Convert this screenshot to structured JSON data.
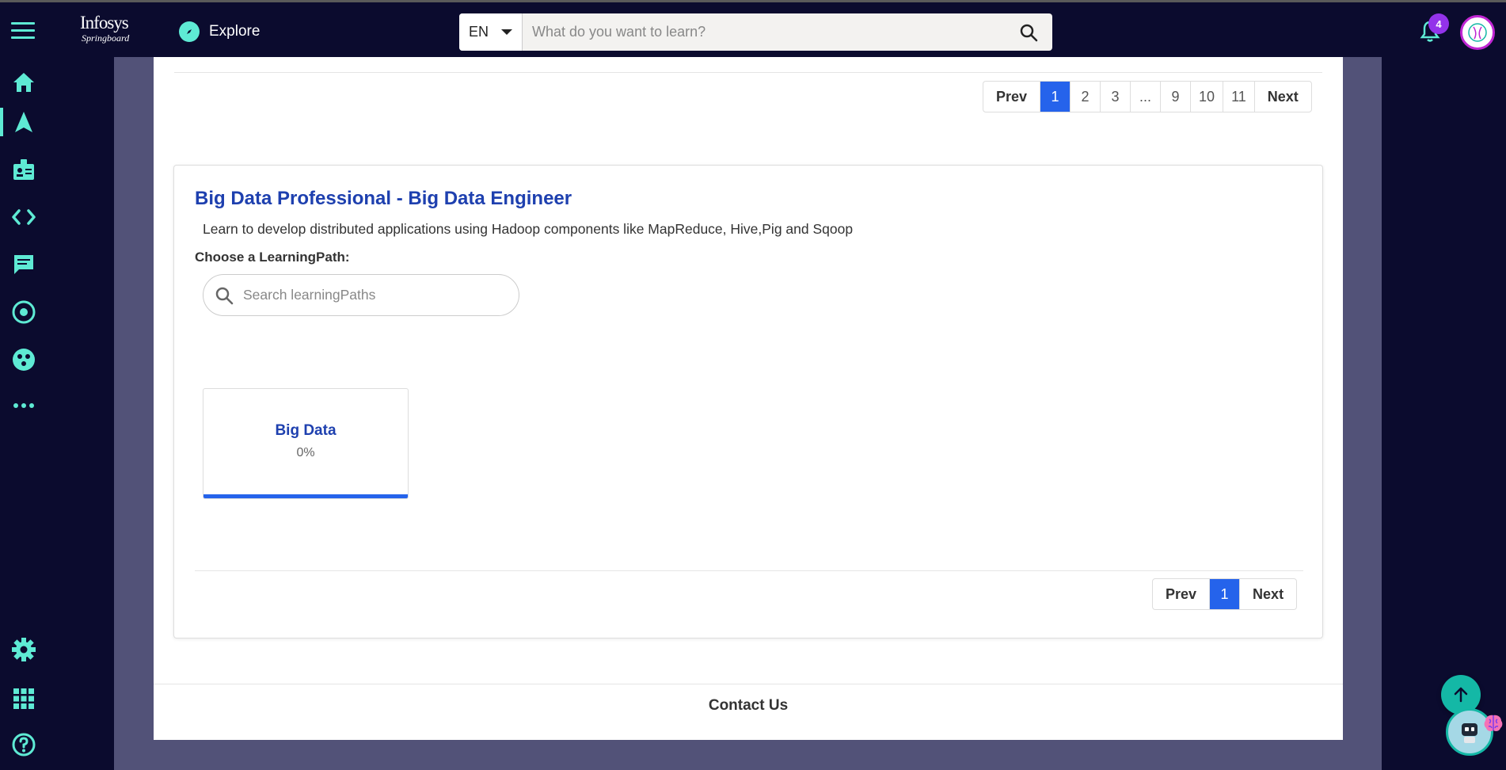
{
  "header": {
    "logo_line1": "Infosys",
    "logo_line2": "Springboard",
    "explore_label": "Explore",
    "language": "EN",
    "search_placeholder": "What do you want to learn?",
    "notification_count": "4"
  },
  "sidebar": {
    "items": [
      {
        "name": "home-icon"
      },
      {
        "name": "navigate-icon",
        "active": true
      },
      {
        "name": "badge-icon"
      },
      {
        "name": "code-icon"
      },
      {
        "name": "chat-icon"
      },
      {
        "name": "target-icon"
      },
      {
        "name": "community-icon"
      },
      {
        "name": "more-icon"
      },
      {
        "name": "settings-icon"
      },
      {
        "name": "apps-icon"
      },
      {
        "name": "help-icon"
      }
    ]
  },
  "top_pagination": {
    "prev": "Prev",
    "pages": [
      "1",
      "2",
      "3",
      "...",
      "9",
      "10",
      "11"
    ],
    "active": "1",
    "next": "Next"
  },
  "card": {
    "title": "Big Data Professional - Big Data Engineer",
    "description": "Learn to develop distributed applications using Hadoop components like MapReduce, Hive,Pig and Sqoop",
    "choose_label": "Choose a LearningPath:",
    "search_placeholder": "Search learningPaths",
    "paths": [
      {
        "name": "Big Data",
        "progress": "0%"
      }
    ],
    "pagination": {
      "prev": "Prev",
      "pages": [
        "1"
      ],
      "active": "1",
      "next": "Next"
    }
  },
  "footer": {
    "contact_label": "Contact Us"
  },
  "colors": {
    "background": "#0b0b2e",
    "accent": "#5eead4",
    "primary": "#2563eb",
    "title": "#1e40af",
    "badge": "#9333ea"
  }
}
